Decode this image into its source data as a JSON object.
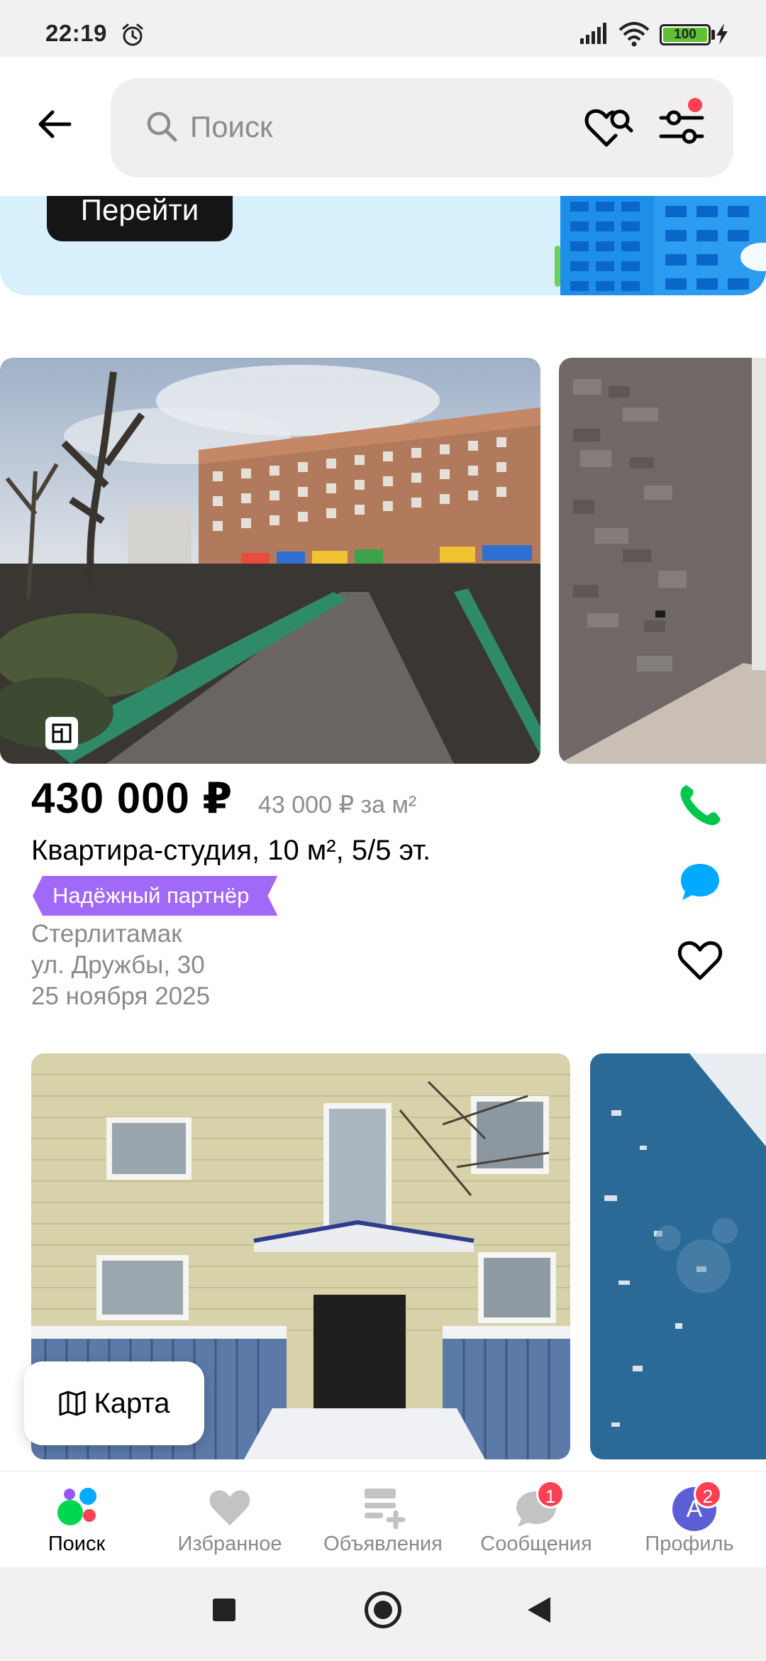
{
  "status_bar": {
    "time": "22:19",
    "battery": "100",
    "battery_level": 1.0
  },
  "header": {
    "search_placeholder": "Поиск"
  },
  "banner": {
    "button_label": "Перейти"
  },
  "listings": [
    {
      "price": "430 000 ₽",
      "price_per_m2": "43 000 ₽ за м²",
      "title": "Квартира-студия, 10 м², 5/5 эт.",
      "badge": "Надёжный партнёр",
      "city": "Стерлитамак",
      "address": "ул. Дружбы, 30",
      "date": "25 ноября 2025"
    }
  ],
  "map_button": {
    "label": "Карта"
  },
  "bottom_nav": {
    "items": [
      {
        "label": "Поиск",
        "icon": "search-dots-icon",
        "active": true
      },
      {
        "label": "Избранное",
        "icon": "heart-icon"
      },
      {
        "label": "Объявления",
        "icon": "add-listing-icon"
      },
      {
        "label": "Сообщения",
        "icon": "chat-icon",
        "badge": "1"
      },
      {
        "label": "Профиль",
        "icon": "avatar",
        "badge": "2",
        "avatar_letter": "A"
      }
    ]
  },
  "colors": {
    "accent_purple": "#a169f7",
    "phone_green": "#00c74c",
    "chat_blue": "#00aaff",
    "badge_red": "#ff4053",
    "banner_bg": "#d7f0fb"
  }
}
